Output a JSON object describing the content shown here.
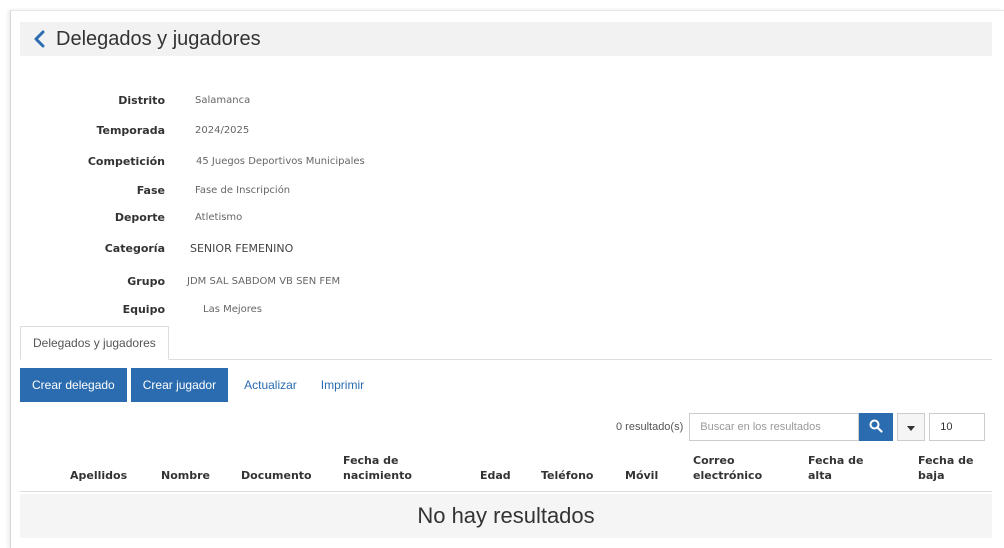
{
  "header": {
    "title": "Delegados y jugadores"
  },
  "fields": [
    {
      "label": "Distrito",
      "value": "Salamanca"
    },
    {
      "label": "Temporada",
      "value": "2024/2025"
    },
    {
      "label": "Competición",
      "value": "45 Juegos Deportivos Municipales"
    },
    {
      "label": "Fase",
      "value": "Fase de Inscripción"
    },
    {
      "label": "Deporte",
      "value": "Atletismo"
    },
    {
      "label": "Categoría",
      "value": "SENIOR FEMENINO"
    },
    {
      "label": "Grupo",
      "value": "JDM SAL SABDOM VB SEN FEM"
    },
    {
      "label": "Equipo",
      "value": "Las Mejores"
    }
  ],
  "tabs": [
    {
      "label": "Delegados y jugadores"
    }
  ],
  "toolbar": {
    "create_delegate": "Crear delegado",
    "create_player": "Crear jugador",
    "refresh": "Actualizar",
    "print": "Imprimir"
  },
  "search": {
    "count": "0 resultado(s)",
    "placeholder": "Buscar en los resultados",
    "page_size": "10"
  },
  "table": {
    "columns": [
      {
        "line1": "",
        "line2": "Apellidos"
      },
      {
        "line1": "",
        "line2": "Nombre"
      },
      {
        "line1": "",
        "line2": "Documento"
      },
      {
        "line1": "Fecha de",
        "line2": "nacimiento"
      },
      {
        "line1": "",
        "line2": "Edad"
      },
      {
        "line1": "",
        "line2": "Teléfono"
      },
      {
        "line1": "",
        "line2": "Móvil"
      },
      {
        "line1": "Correo",
        "line2": "electrónico"
      },
      {
        "line1": "Fecha de",
        "line2": "alta"
      },
      {
        "line1": "Fecha de",
        "line2": "baja"
      }
    ],
    "empty_message": "No hay resultados"
  },
  "colors": {
    "primary": "#2b6cb0",
    "header_bg": "#f2f2f2",
    "empty_bg": "#f5f5f5"
  }
}
